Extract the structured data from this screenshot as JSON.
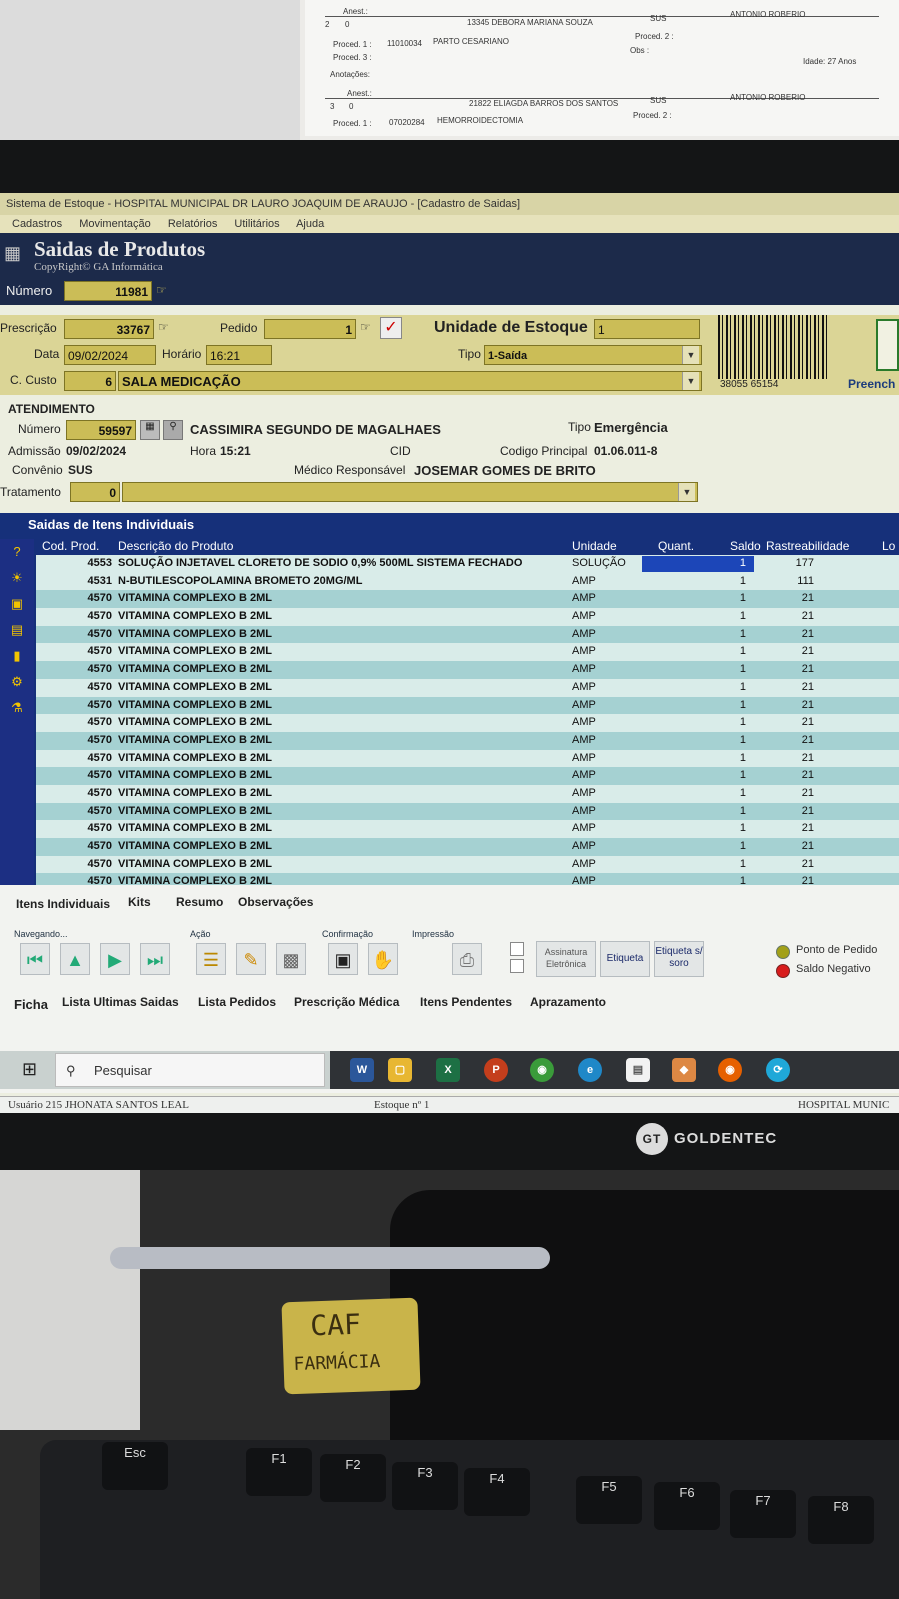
{
  "paper": {
    "line1_label": "Anest.:",
    "line2_num": "2",
    "line2_zero": "0",
    "line2_patient": "13345 DEBORA MARIANA SOUZA",
    "line2_sus": "SUS",
    "line2_doctor": "ANTONIO ROBERIO",
    "line3_proc1": "Proced. 1 :",
    "line3_code": "11010034",
    "line3_desc": "PARTO CESARIANO",
    "line3_proc2": "Proced. 2 :",
    "line4_proc3": "Proced. 3 :",
    "line4_obs": "Obs :",
    "line4_age": "Idade: 27 Anos",
    "line5_anot": "Anotações:",
    "line6_anest": "Anest.:",
    "line7_num": "3",
    "line7_zero": "0",
    "line7_patient": "21822 ELIAGDA BARROS DOS SANTOS",
    "line7_sus": "SUS",
    "line7_doctor": "ANTONIO ROBERIO",
    "line8_proc1": "Proced. 1 :",
    "line8_code": "07020284",
    "line8_desc": "HEMORROIDECTOMIA",
    "line8_proc2": "Proced. 2 :"
  },
  "window": {
    "title": "Sistema de Estoque - HOSPITAL MUNICIPAL DR LAURO JOAQUIM DE ARAUJO - [Cadastro de Saidas]",
    "menu": [
      "Cadastros",
      "Movimentação",
      "Relatórios",
      "Utilitários",
      "Ajuda"
    ]
  },
  "banner": {
    "title": "Saidas de Produtos",
    "copyright": "CopyRight© GA Informática"
  },
  "header": {
    "numero_label": "Número",
    "numero_value": "11981",
    "prescricao_label": "Prescrição",
    "prescricao_value": "33767",
    "pedido_label": "Pedido",
    "pedido_value": "1",
    "unidade_label": "Unidade de Estoque",
    "unidade_value": "1",
    "data_label": "Data",
    "data_value": "09/02/2024",
    "horario_label": "Horário",
    "horario_value": "16:21",
    "tipo_label": "Tipo",
    "tipo_value": "1-Saída",
    "custo_label": "C. Custo",
    "custo_code": "6",
    "custo_value": "SALA MEDICAÇÃO",
    "barcode_number": "38055 65154",
    "preencher_label": "Preench"
  },
  "atendimento": {
    "section_label": "ATENDIMENTO",
    "numero_label": "Número",
    "numero_value": "59597",
    "patient_name": "CASSIMIRA SEGUNDO DE MAGALHAES",
    "tipo_label": "Tipo",
    "tipo_value": "Emergência",
    "admissao_label": "Admissão",
    "admissao_value": "09/02/2024",
    "hora_label": "Hora",
    "hora_value": "15:21",
    "cid_label": "CID",
    "codigo_label": "Codigo Principal",
    "codigo_value": "01.06.011-8",
    "convenio_label": "Convênio",
    "convenio_value": "SUS",
    "medico_label": "Médico Responsável",
    "medico_value": "JOSEMAR GOMES DE BRITO",
    "tratamento_label": "Tratamento",
    "tratamento_value": "0"
  },
  "grid": {
    "title": "Saidas de Itens Individuais",
    "columns": [
      "Cod. Prod.",
      "Descrição do Produto",
      "Unidade",
      "Quant.",
      "Saldo",
      "Rastreabilidade",
      "Lo"
    ],
    "rows": [
      {
        "cod": "4553",
        "desc": "SOLUÇÃO INJETAVEL CLORETO DE SODIO 0,9% 500ML SISTEMA FECHADO",
        "un": "SOLUÇÃO",
        "qt": "1",
        "saldo": "177"
      },
      {
        "cod": "4531",
        "desc": "N-BUTILESCOPOLAMINA BROMETO 20MG/ML",
        "un": "AMP",
        "qt": "1",
        "saldo": "111"
      },
      {
        "cod": "4570",
        "desc": "VITAMINA COMPLEXO B 2ML",
        "un": "AMP",
        "qt": "1",
        "saldo": "21"
      },
      {
        "cod": "4570",
        "desc": "VITAMINA COMPLEXO B 2ML",
        "un": "AMP",
        "qt": "1",
        "saldo": "21"
      },
      {
        "cod": "4570",
        "desc": "VITAMINA COMPLEXO B 2ML",
        "un": "AMP",
        "qt": "1",
        "saldo": "21"
      },
      {
        "cod": "4570",
        "desc": "VITAMINA COMPLEXO B 2ML",
        "un": "AMP",
        "qt": "1",
        "saldo": "21"
      },
      {
        "cod": "4570",
        "desc": "VITAMINA COMPLEXO B 2ML",
        "un": "AMP",
        "qt": "1",
        "saldo": "21"
      },
      {
        "cod": "4570",
        "desc": "VITAMINA COMPLEXO B 2ML",
        "un": "AMP",
        "qt": "1",
        "saldo": "21"
      },
      {
        "cod": "4570",
        "desc": "VITAMINA COMPLEXO B 2ML",
        "un": "AMP",
        "qt": "1",
        "saldo": "21"
      },
      {
        "cod": "4570",
        "desc": "VITAMINA COMPLEXO B 2ML",
        "un": "AMP",
        "qt": "1",
        "saldo": "21"
      },
      {
        "cod": "4570",
        "desc": "VITAMINA COMPLEXO B 2ML",
        "un": "AMP",
        "qt": "1",
        "saldo": "21"
      },
      {
        "cod": "4570",
        "desc": "VITAMINA COMPLEXO B 2ML",
        "un": "AMP",
        "qt": "1",
        "saldo": "21"
      },
      {
        "cod": "4570",
        "desc": "VITAMINA COMPLEXO B 2ML",
        "un": "AMP",
        "qt": "1",
        "saldo": "21"
      },
      {
        "cod": "4570",
        "desc": "VITAMINA COMPLEXO B 2ML",
        "un": "AMP",
        "qt": "1",
        "saldo": "21"
      },
      {
        "cod": "4570",
        "desc": "VITAMINA COMPLEXO B 2ML",
        "un": "AMP",
        "qt": "1",
        "saldo": "21"
      },
      {
        "cod": "4570",
        "desc": "VITAMINA COMPLEXO B 2ML",
        "un": "AMP",
        "qt": "1",
        "saldo": "21"
      },
      {
        "cod": "4570",
        "desc": "VITAMINA COMPLEXO B 2ML",
        "un": "AMP",
        "qt": "1",
        "saldo": "21"
      },
      {
        "cod": "4570",
        "desc": "VITAMINA COMPLEXO B 2ML",
        "un": "AMP",
        "qt": "1",
        "saldo": "21"
      },
      {
        "cod": "4570",
        "desc": "VITAMINA COMPLEXO B 2ML",
        "un": "AMP",
        "qt": "1",
        "saldo": "21"
      }
    ]
  },
  "tabs": {
    "top": [
      "Itens Individuais",
      "Kits",
      "Resumo",
      "Observações"
    ],
    "group_navegando": "Navegando...",
    "group_acao": "Ação",
    "group_confirmacao": "Confirmação",
    "group_impressao": "Impressão",
    "btn_assinatura": "Assinatura Eletrônica",
    "btn_etiqueta": "Etiqueta",
    "btn_etiqueta_soro": "Etiqueta s/ soro",
    "legend_ponto": "Ponto de Pedido",
    "legend_saldo": "Saldo Negativo",
    "bottom": [
      "Ficha",
      "Lista Ultimas Saidas",
      "Lista Pedidos",
      "Prescrição Médica",
      "Itens Pendentes",
      "Aprazamento"
    ]
  },
  "status": {
    "usuario": "Usuário 215 JHONATA SANTOS LEAL",
    "estoque": "Estoque nº 1",
    "hospital": "HOSPITAL MUNIC"
  },
  "taskbar": {
    "search_placeholder": "Pesquisar"
  },
  "monitor": {
    "brand": "GOLDENTEC",
    "logo": "GT"
  },
  "desk": {
    "tag_line1": "CAF",
    "tag_line2": "FARMÁCIA",
    "keys": [
      "Esc",
      "F1",
      "F2",
      "F3",
      "F4",
      "F5",
      "F6",
      "F7",
      "F8"
    ]
  },
  "colors": {
    "field": "#cbbd57",
    "navy": "#1c2a4a",
    "grid_blue": "#16307a",
    "row_light": "#d9ece9",
    "row_dark": "#a5d1d2",
    "selection": "#1c46b8"
  }
}
